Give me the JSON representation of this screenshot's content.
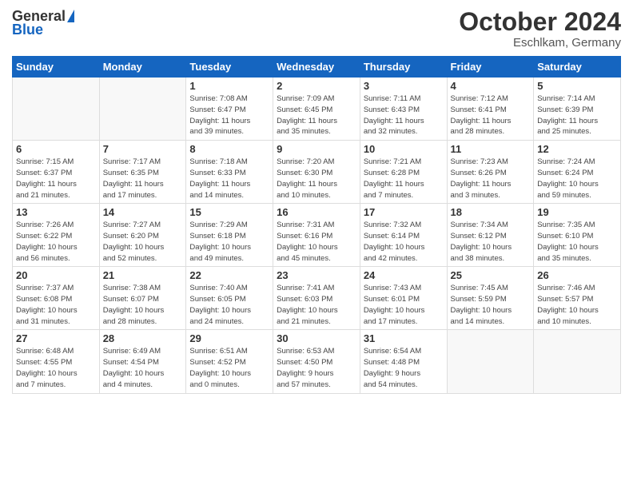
{
  "header": {
    "logo_general": "General",
    "logo_blue": "Blue",
    "month_title": "October 2024",
    "location": "Eschlkam, Germany"
  },
  "weekdays": [
    "Sunday",
    "Monday",
    "Tuesday",
    "Wednesday",
    "Thursday",
    "Friday",
    "Saturday"
  ],
  "weeks": [
    [
      {
        "day": "",
        "info": ""
      },
      {
        "day": "",
        "info": ""
      },
      {
        "day": "1",
        "info": "Sunrise: 7:08 AM\nSunset: 6:47 PM\nDaylight: 11 hours and 39 minutes."
      },
      {
        "day": "2",
        "info": "Sunrise: 7:09 AM\nSunset: 6:45 PM\nDaylight: 11 hours and 35 minutes."
      },
      {
        "day": "3",
        "info": "Sunrise: 7:11 AM\nSunset: 6:43 PM\nDaylight: 11 hours and 32 minutes."
      },
      {
        "day": "4",
        "info": "Sunrise: 7:12 AM\nSunset: 6:41 PM\nDaylight: 11 hours and 28 minutes."
      },
      {
        "day": "5",
        "info": "Sunrise: 7:14 AM\nSunset: 6:39 PM\nDaylight: 11 hours and 25 minutes."
      }
    ],
    [
      {
        "day": "6",
        "info": "Sunrise: 7:15 AM\nSunset: 6:37 PM\nDaylight: 11 hours and 21 minutes."
      },
      {
        "day": "7",
        "info": "Sunrise: 7:17 AM\nSunset: 6:35 PM\nDaylight: 11 hours and 17 minutes."
      },
      {
        "day": "8",
        "info": "Sunrise: 7:18 AM\nSunset: 6:33 PM\nDaylight: 11 hours and 14 minutes."
      },
      {
        "day": "9",
        "info": "Sunrise: 7:20 AM\nSunset: 6:30 PM\nDaylight: 11 hours and 10 minutes."
      },
      {
        "day": "10",
        "info": "Sunrise: 7:21 AM\nSunset: 6:28 PM\nDaylight: 11 hours and 7 minutes."
      },
      {
        "day": "11",
        "info": "Sunrise: 7:23 AM\nSunset: 6:26 PM\nDaylight: 11 hours and 3 minutes."
      },
      {
        "day": "12",
        "info": "Sunrise: 7:24 AM\nSunset: 6:24 PM\nDaylight: 10 hours and 59 minutes."
      }
    ],
    [
      {
        "day": "13",
        "info": "Sunrise: 7:26 AM\nSunset: 6:22 PM\nDaylight: 10 hours and 56 minutes."
      },
      {
        "day": "14",
        "info": "Sunrise: 7:27 AM\nSunset: 6:20 PM\nDaylight: 10 hours and 52 minutes."
      },
      {
        "day": "15",
        "info": "Sunrise: 7:29 AM\nSunset: 6:18 PM\nDaylight: 10 hours and 49 minutes."
      },
      {
        "day": "16",
        "info": "Sunrise: 7:31 AM\nSunset: 6:16 PM\nDaylight: 10 hours and 45 minutes."
      },
      {
        "day": "17",
        "info": "Sunrise: 7:32 AM\nSunset: 6:14 PM\nDaylight: 10 hours and 42 minutes."
      },
      {
        "day": "18",
        "info": "Sunrise: 7:34 AM\nSunset: 6:12 PM\nDaylight: 10 hours and 38 minutes."
      },
      {
        "day": "19",
        "info": "Sunrise: 7:35 AM\nSunset: 6:10 PM\nDaylight: 10 hours and 35 minutes."
      }
    ],
    [
      {
        "day": "20",
        "info": "Sunrise: 7:37 AM\nSunset: 6:08 PM\nDaylight: 10 hours and 31 minutes."
      },
      {
        "day": "21",
        "info": "Sunrise: 7:38 AM\nSunset: 6:07 PM\nDaylight: 10 hours and 28 minutes."
      },
      {
        "day": "22",
        "info": "Sunrise: 7:40 AM\nSunset: 6:05 PM\nDaylight: 10 hours and 24 minutes."
      },
      {
        "day": "23",
        "info": "Sunrise: 7:41 AM\nSunset: 6:03 PM\nDaylight: 10 hours and 21 minutes."
      },
      {
        "day": "24",
        "info": "Sunrise: 7:43 AM\nSunset: 6:01 PM\nDaylight: 10 hours and 17 minutes."
      },
      {
        "day": "25",
        "info": "Sunrise: 7:45 AM\nSunset: 5:59 PM\nDaylight: 10 hours and 14 minutes."
      },
      {
        "day": "26",
        "info": "Sunrise: 7:46 AM\nSunset: 5:57 PM\nDaylight: 10 hours and 10 minutes."
      }
    ],
    [
      {
        "day": "27",
        "info": "Sunrise: 6:48 AM\nSunset: 4:55 PM\nDaylight: 10 hours and 7 minutes."
      },
      {
        "day": "28",
        "info": "Sunrise: 6:49 AM\nSunset: 4:54 PM\nDaylight: 10 hours and 4 minutes."
      },
      {
        "day": "29",
        "info": "Sunrise: 6:51 AM\nSunset: 4:52 PM\nDaylight: 10 hours and 0 minutes."
      },
      {
        "day": "30",
        "info": "Sunrise: 6:53 AM\nSunset: 4:50 PM\nDaylight: 9 hours and 57 minutes."
      },
      {
        "day": "31",
        "info": "Sunrise: 6:54 AM\nSunset: 4:48 PM\nDaylight: 9 hours and 54 minutes."
      },
      {
        "day": "",
        "info": ""
      },
      {
        "day": "",
        "info": ""
      }
    ]
  ]
}
